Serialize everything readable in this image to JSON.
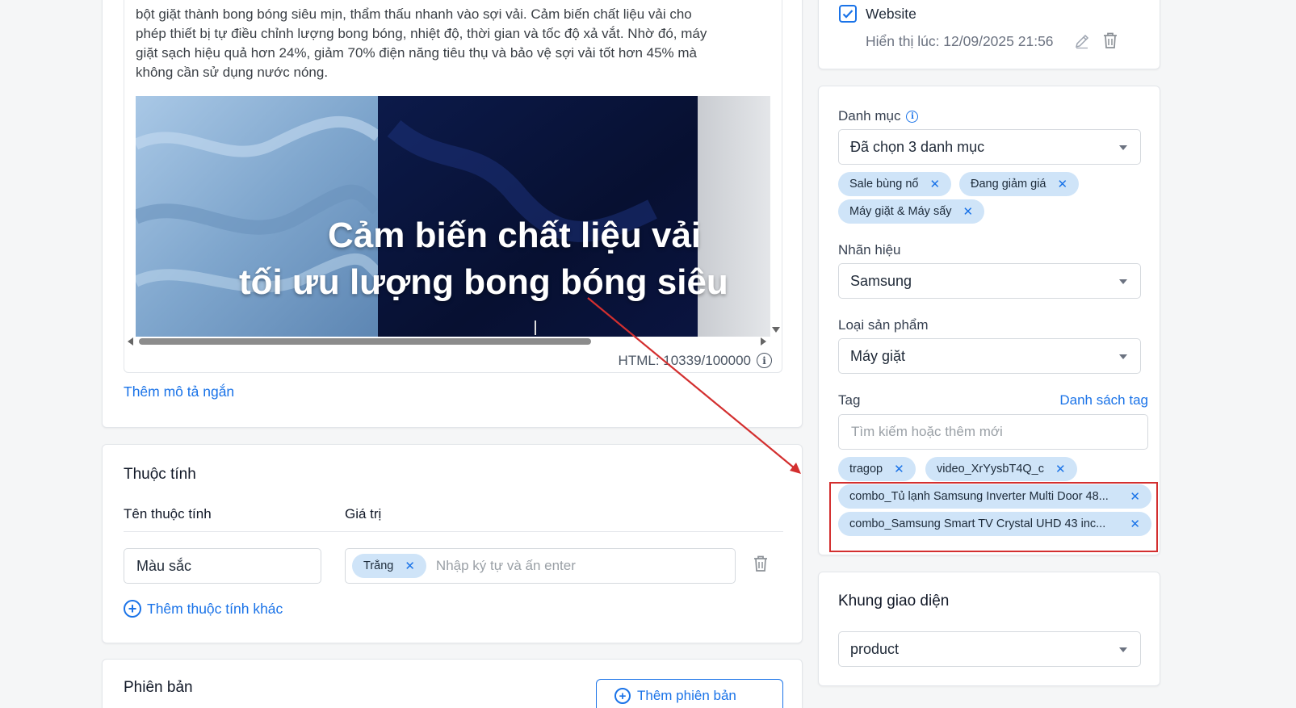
{
  "description": {
    "lines": [
      "bột giặt thành bong bóng siêu mịn, thẩm thấu nhanh vào sợi vải. Cảm biến chất liệu vải cho",
      "phép thiết bị tự điều chỉnh lượng bong bóng, nhiệt độ, thời gian và tốc độ xả vắt. Nhờ đó, máy",
      "giặt sạch hiệu quả hơn 24%, giảm 70% điện năng tiêu thụ và bảo vệ sợi vải tốt hơn 45% mà",
      "không cần sử dụng nước nóng."
    ],
    "image_caption_line1": "Cảm biến chất liệu vải",
    "image_caption_line2": "tối ưu lượng bong bóng siêu",
    "html_counter": "HTML: 10339/100000",
    "add_short_desc": "Thêm mô tả ngắn"
  },
  "attributes": {
    "title": "Thuộc tính",
    "col_name": "Tên thuộc tính",
    "col_value": "Giá trị",
    "name_value": "Màu sắc",
    "value_chip": "Trắng",
    "value_placeholder": "Nhập ký tự và ấn enter",
    "add_more": "Thêm thuộc tính khác"
  },
  "variants": {
    "title": "Phiên bản",
    "add_button": "Thêm phiên bản"
  },
  "channel": {
    "website_label": "Website",
    "display_time": "Hiển thị lúc: 12/09/2025 21:56"
  },
  "organize": {
    "category_label": "Danh mục",
    "category_value": "Đã chọn 3 danh mục",
    "category_chips": [
      "Sale bùng nổ",
      "Đang giảm giá",
      "Máy giặt & Máy sấy"
    ],
    "brand_label": "Nhãn hiệu",
    "brand_value": "Samsung",
    "type_label": "Loại sản phẩm",
    "type_value": "Máy giặt",
    "tag_label": "Tag",
    "tag_list_link": "Danh sách tag",
    "tag_placeholder": "Tìm kiếm hoặc thêm mới",
    "tags": [
      "tragop",
      "video_XrYysbT4Q_c",
      "combo_Tủ lạnh Samsung Inverter Multi Door 48...",
      "combo_Samsung Smart TV Crystal UHD 43 inc..."
    ]
  },
  "template": {
    "title": "Khung giao diện",
    "value": "product"
  },
  "colors": {
    "accent": "#1a73e8",
    "chip_bg": "#cfe4f8",
    "highlight": "#d32f2f"
  }
}
